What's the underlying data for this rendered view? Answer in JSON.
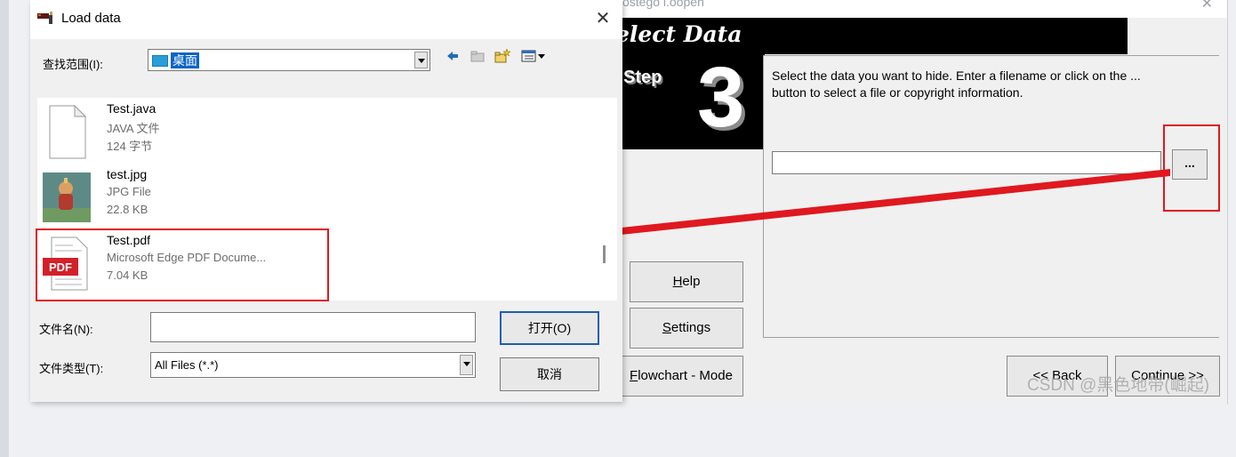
{
  "dialog": {
    "title": "Load data",
    "look_in_label": "查找范围(I):",
    "look_in_value": "桌面",
    "files": [
      {
        "name": "Test.java",
        "type": "JAVA 文件",
        "size": "124 字节",
        "icon": "java-file-icon"
      },
      {
        "name": "test.jpg",
        "type": "JPG File",
        "size": "22.8 KB",
        "icon": "image-thumbnail"
      },
      {
        "name": "Test.pdf",
        "type": "Microsoft Edge PDF Docume...",
        "size": "7.04 KB",
        "icon": "pdf-file-icon"
      }
    ],
    "pdf_badge": "PDF",
    "filename_label": "文件名(N):",
    "filename_value": "",
    "filetype_label": "文件类型(T):",
    "filetype_value": "All Files (*.*)",
    "open_button": "打开(O)",
    "cancel_button": "取消",
    "close_glyph": "✕"
  },
  "wizard": {
    "title": "ostego i.oopen",
    "close_glyph": "✕",
    "banner_title": "elect Data",
    "step_label": "Step",
    "step_number": "3",
    "instruction": "Select the data you want to hide. Enter a filename or click on the ... button to select a file or copyright information.",
    "file_value": "",
    "browse_button": "...",
    "help_button": {
      "accel": "H",
      "rest": "elp"
    },
    "settings_button": {
      "accel": "S",
      "rest": "ettings"
    },
    "flowchart_button": {
      "accel": "F",
      "rest": "lowchart - Mode"
    },
    "back_button": "<< Back",
    "continue_button": "Continue >>"
  },
  "watermark": "CSDN @黑色地带(崛起)",
  "colors": {
    "highlight_red": "#e0181f",
    "selection_blue": "#0a64c8"
  }
}
